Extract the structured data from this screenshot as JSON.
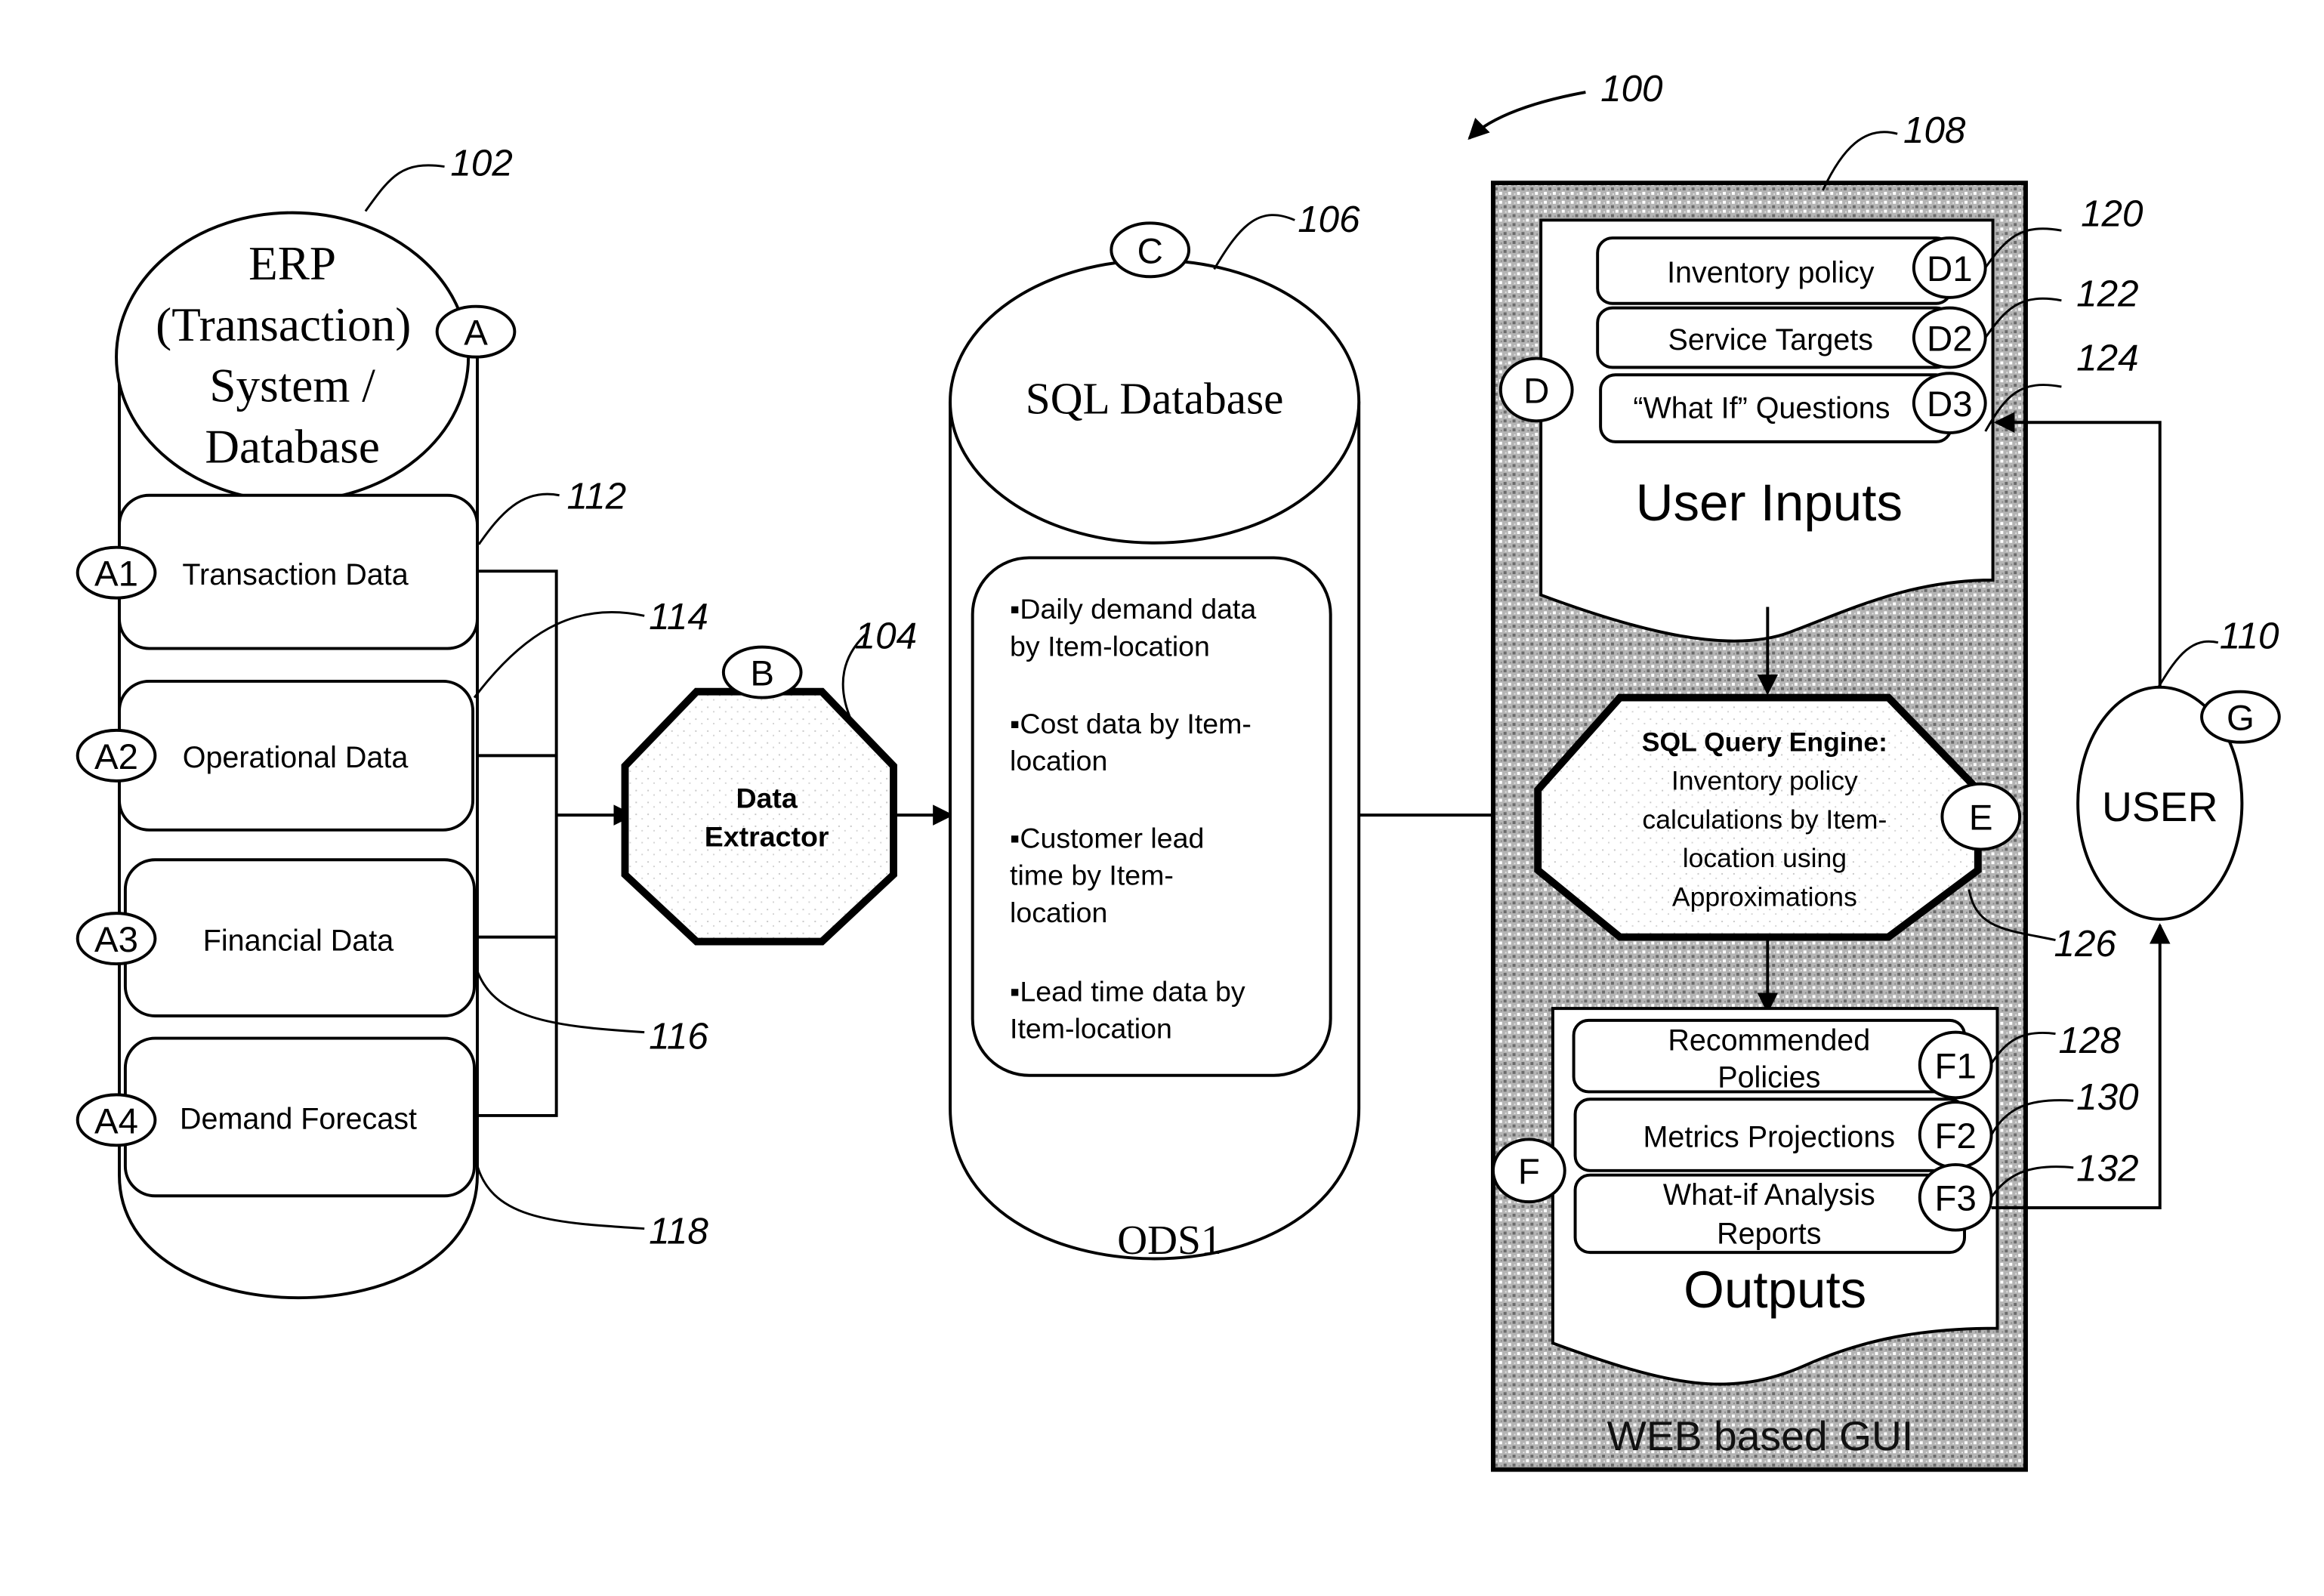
{
  "figure": {
    "ref": "100",
    "colors": {
      "ink": "#000000",
      "paper": "#ffffff",
      "gui_texture": "#a8a8a8"
    }
  },
  "erp": {
    "ref": "102",
    "title_lines": [
      "ERP",
      "(Transaction)",
      "System /",
      "Database"
    ],
    "tag": "A",
    "items": [
      {
        "tag": "A1",
        "label": "Transaction Data",
        "ref": "112"
      },
      {
        "tag": "A2",
        "label": "Operational Data",
        "ref": "114"
      },
      {
        "tag": "A3",
        "label": "Financial Data",
        "ref": "116"
      },
      {
        "tag": "A4",
        "label": "Demand Forecast",
        "ref": "118"
      }
    ]
  },
  "extractor": {
    "ref": "104",
    "tag": "B",
    "label_lines": [
      "Data",
      "Extractor"
    ]
  },
  "sql_db": {
    "ref": "106",
    "tag": "C",
    "title": "SQL Database",
    "footer": "ODS1",
    "bullets": [
      [
        "▪Daily demand data",
        "by Item-location"
      ],
      [
        "▪Cost data by Item-",
        "location"
      ],
      [
        "▪Customer lead",
        "time by Item-",
        "location"
      ],
      [
        "▪Lead time data by",
        "Item-location"
      ]
    ]
  },
  "web_gui": {
    "ref": "108",
    "label": "WEB based GUI",
    "user_inputs": {
      "tag": "D",
      "title": "User Inputs",
      "items": [
        {
          "tag": "D1",
          "label": "Inventory policy",
          "ref": "120"
        },
        {
          "tag": "D2",
          "label": "Service Targets",
          "ref": "122"
        },
        {
          "tag": "D3",
          "label": "“What If” Questions",
          "ref": "124"
        }
      ]
    },
    "engine": {
      "ref": "126",
      "tag": "E",
      "title": "SQL Query Engine:",
      "body_lines": [
        "Inventory policy",
        "calculations by Item-",
        "location using",
        "Approximations"
      ]
    },
    "outputs": {
      "tag": "F",
      "title": "Outputs",
      "items": [
        {
          "tag": "F1",
          "label_lines": [
            "Recommended",
            "Policies"
          ],
          "ref": "128"
        },
        {
          "tag": "F2",
          "label_lines": [
            "Metrics Projections"
          ],
          "ref": "130"
        },
        {
          "tag": "F3",
          "label_lines": [
            "What-if Analysis",
            "Reports"
          ],
          "ref": "132"
        }
      ]
    }
  },
  "user": {
    "ref": "110",
    "tag": "G",
    "label": "USER"
  }
}
